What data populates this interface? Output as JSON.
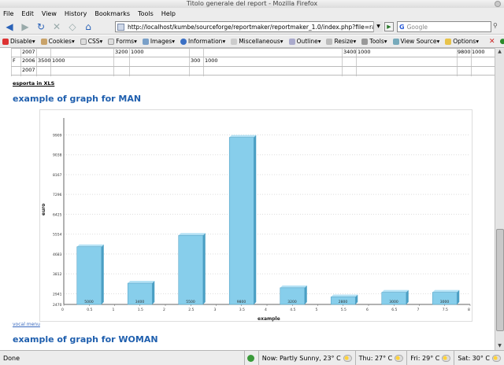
{
  "window": {
    "title": "Titolo generale del report - Mozilla Firefox"
  },
  "menu": [
    "File",
    "Edit",
    "View",
    "History",
    "Bookmarks",
    "Tools",
    "Help"
  ],
  "nav": {
    "url": "http://localhost/kumbe/sourceforge/reportmaker/reportmaker_1.0/index.php?file=raggr",
    "search_placeholder": "Google"
  },
  "devbar": [
    "Disable",
    "Cookies",
    "CSS",
    "Forms",
    "Images",
    "Information",
    "Miscellaneous",
    "Outline",
    "Resize",
    "Tools",
    "View Source",
    "Options"
  ],
  "table": {
    "rows": [
      {
        "year": "2007",
        "c1": "",
        "c2": "",
        "c3": "",
        "c4": "3200",
        "c5": "1000",
        "c6": "",
        "c7": "",
        "c8": "3400",
        "c9": "1000",
        "c10": "9800",
        "c11": "1000",
        "sex": ""
      },
      {
        "year": "2006",
        "c1": "3500",
        "c2": "1000",
        "c3": "",
        "c4": "",
        "c5": "",
        "c6": "300",
        "c7": "1000",
        "c8": "",
        "c9": "",
        "c10": "",
        "c11": "",
        "sex": "F"
      },
      {
        "year": "2007",
        "c1": "",
        "c2": "",
        "c3": "",
        "c4": "",
        "c5": "",
        "c6": "",
        "c7": "",
        "c8": "",
        "c9": "",
        "c10": "",
        "c11": "",
        "sex": ""
      }
    ]
  },
  "content": {
    "export_link": "esporta in XLS",
    "heading_man": "example of graph for MAN",
    "vocal_menu": "vocal menu",
    "heading_woman": "example of graph for WOMAN"
  },
  "chart_data": {
    "type": "bar",
    "xlabel": "example",
    "ylabel": "euro",
    "yticks": [
      "2470",
      "2941",
      "3812",
      "4683",
      "5554",
      "6425",
      "7296",
      "8167",
      "9038",
      "9909"
    ],
    "ylim": [
      2470,
      10650
    ],
    "xticks": [
      "0",
      "0.5",
      "1",
      "1.5",
      "2",
      "2.5",
      "3",
      "3.5",
      "4",
      "4.5",
      "5",
      "5.5",
      "6",
      "6.5",
      "7",
      "7.5",
      "8"
    ],
    "categories": [
      "5000",
      "3400",
      "5500",
      "9800",
      "3200",
      "2800",
      "3000",
      "3000"
    ],
    "values": [
      5000,
      3400,
      5500,
      9800,
      3200,
      2800,
      3000,
      3000
    ],
    "grid": true,
    "colors": {
      "bar": "#87ceeb",
      "bar_side": "#4a9fc4",
      "bar_top": "#b5e2f5"
    }
  },
  "status": {
    "left": "Done",
    "weather_now": "Now: Partly Sunny, 23° C",
    "thu": "Thu: 27° C",
    "fri": "Fri: 29° C",
    "sat": "Sat: 30° C"
  }
}
